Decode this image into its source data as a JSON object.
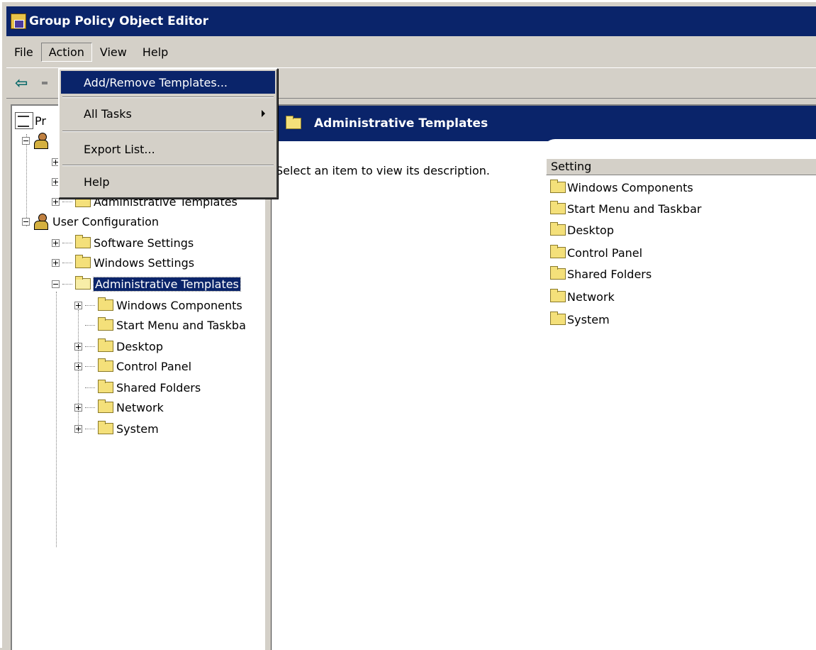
{
  "window": {
    "title": "Group Policy Object Editor"
  },
  "menubar": {
    "file": "File",
    "action": "Action",
    "view": "View",
    "help": "Help"
  },
  "action_menu": {
    "add_remove_templates": "Add/Remove Templates...",
    "all_tasks": "All Tasks",
    "export_list": "Export List...",
    "help": "Help"
  },
  "tree": {
    "root_partial": "Pr",
    "computer_admin_templates": "Administrative Templates",
    "user_configuration": "User Configuration",
    "software_settings": "Software Settings",
    "windows_settings": "Windows Settings",
    "administrative_templates": "Administrative Templates",
    "children": [
      {
        "label": "Windows Components",
        "expandable": true
      },
      {
        "label": "Start Menu and Taskba",
        "expandable": false
      },
      {
        "label": "Desktop",
        "expandable": true
      },
      {
        "label": "Control Panel",
        "expandable": true
      },
      {
        "label": "Shared Folders",
        "expandable": false
      },
      {
        "label": "Network",
        "expandable": true
      },
      {
        "label": "System",
        "expandable": true
      }
    ]
  },
  "right_pane": {
    "header_title": "Administrative Templates",
    "description": "Select an item to view its description.",
    "column_setting": "Setting",
    "items": [
      "Windows Components",
      "Start Menu and Taskbar",
      "Desktop",
      "Control Panel",
      "Shared Folders",
      "Network",
      "System"
    ]
  },
  "colors": {
    "titlebar": "#0a246a",
    "chrome": "#d4d0c8",
    "selection": "#0a246a",
    "folder": "#f4e07a"
  }
}
